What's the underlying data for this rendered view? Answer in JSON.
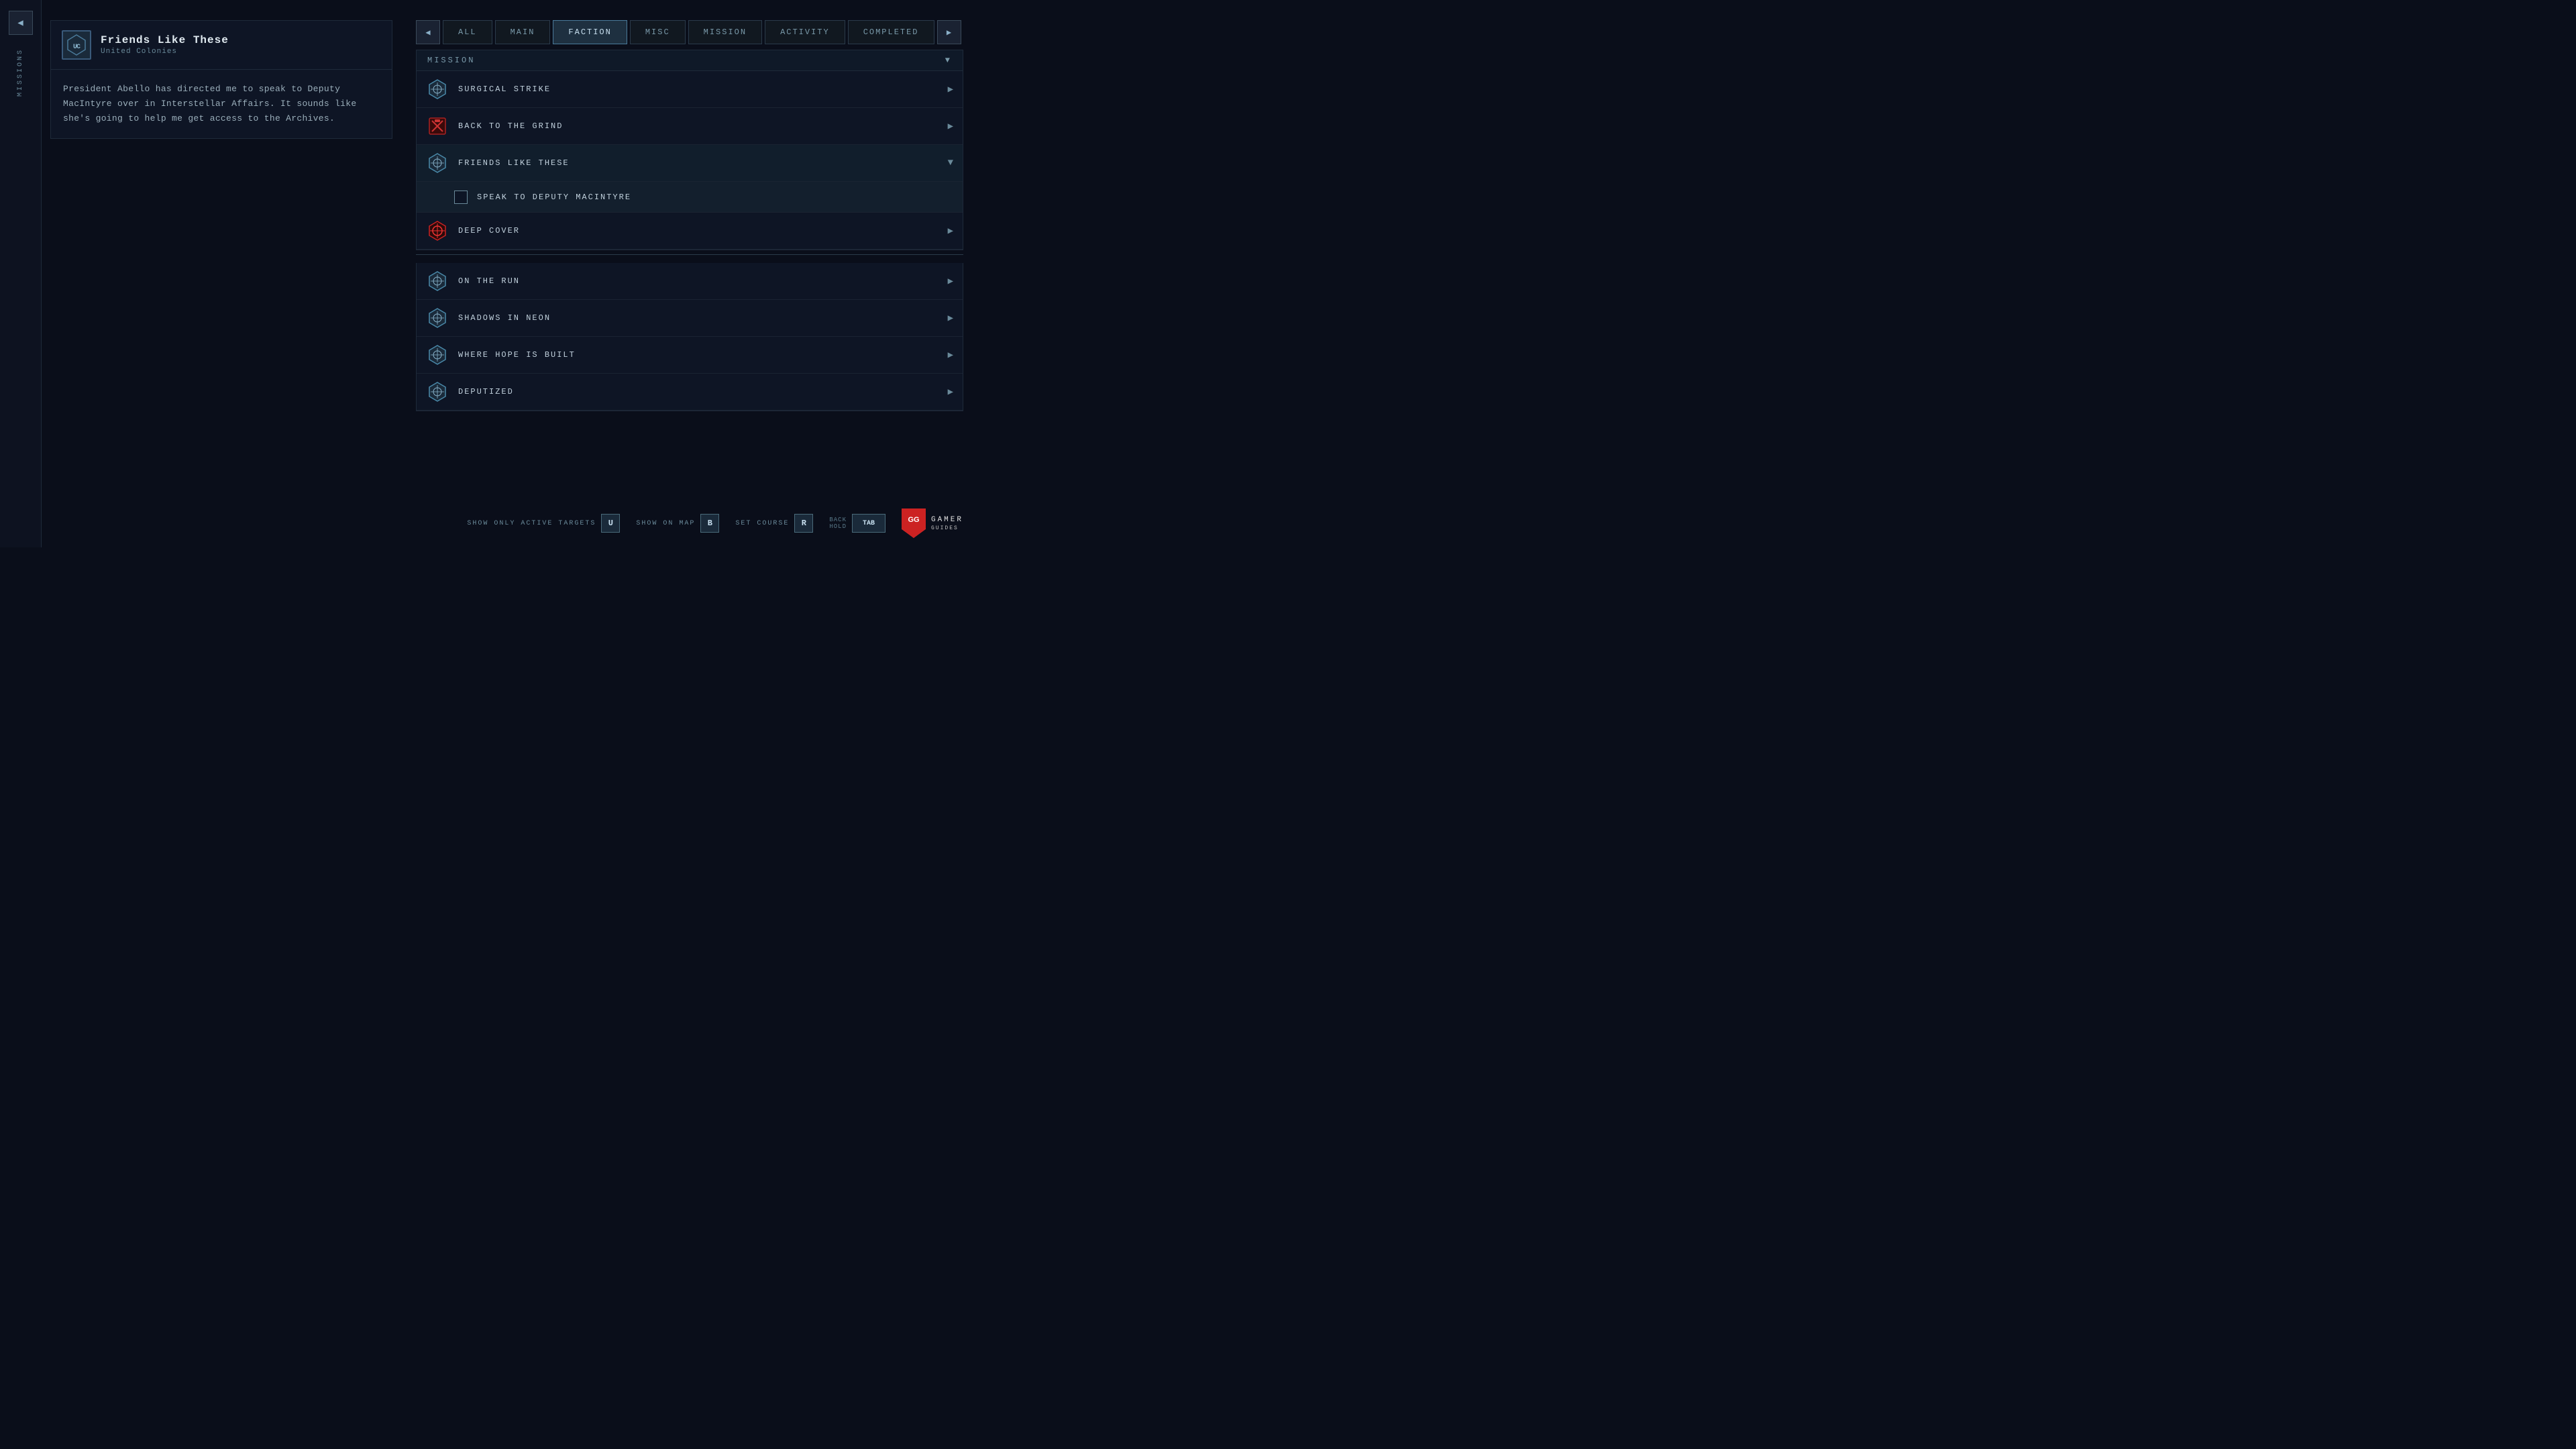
{
  "sidebar": {
    "arrow_label": "◀",
    "label": "MISSIONS"
  },
  "mission_detail": {
    "icon_text": "UC",
    "mission_name": "Friends Like These",
    "faction": "United Colonies",
    "description": "President Abello has directed me to speak to Deputy MacIntyre over in Interstellar Affairs. It sounds like she's going to help me get access to the Archives."
  },
  "tabs": {
    "nav_left": "◀",
    "nav_right": "▶",
    "items": [
      {
        "label": "ALL",
        "active": false
      },
      {
        "label": "MAIN",
        "active": false
      },
      {
        "label": "FACTION",
        "active": true
      },
      {
        "label": "MISC",
        "active": false
      },
      {
        "label": "MISSION",
        "active": false
      },
      {
        "label": "ACTIVITY",
        "active": false
      },
      {
        "label": "COMPLETED",
        "active": false
      }
    ]
  },
  "section_label": "MISSION",
  "mission_rows": [
    {
      "id": "surgical-strike",
      "name": "SURGICAL STRIKE",
      "icon": "uc",
      "expanded": false
    },
    {
      "id": "back-to-grind",
      "name": "BACK TO THE GRIND",
      "icon": "cf",
      "expanded": false
    },
    {
      "id": "friends-like-these",
      "name": "FRIENDS LIKE THESE",
      "icon": "uc",
      "expanded": true
    }
  ],
  "subtask": {
    "label": "SPEAK TO DEPUTY MACINTYRE"
  },
  "mission_rows2": [
    {
      "id": "deep-cover",
      "name": "DEEP COVER",
      "icon": "cf2",
      "expanded": false
    }
  ],
  "mission_rows3": [
    {
      "id": "on-the-run",
      "name": "ON THE RUN",
      "icon": "uc"
    },
    {
      "id": "shadows-in-neon",
      "name": "SHADOWS IN NEON",
      "icon": "uc"
    },
    {
      "id": "where-hope-is-built",
      "name": "WHERE HOPE IS BUILT",
      "icon": "uc"
    },
    {
      "id": "deputized",
      "name": "DEPUTIZED",
      "icon": "uc"
    }
  ],
  "bottom_bar": {
    "show_targets_label": "SHOW ONLY ACTIVE TARGETS",
    "show_targets_key": "U",
    "show_map_label": "SHOW ON MAP",
    "show_map_key": "B",
    "set_course_label": "SET COURSE",
    "set_course_key": "R",
    "back_label": "BACK",
    "back_key": "TAB",
    "hold_label": "HOLD"
  },
  "gamer_guides": {
    "logo": "GG",
    "title": "GAMER",
    "subtitle": "GUIDES"
  }
}
